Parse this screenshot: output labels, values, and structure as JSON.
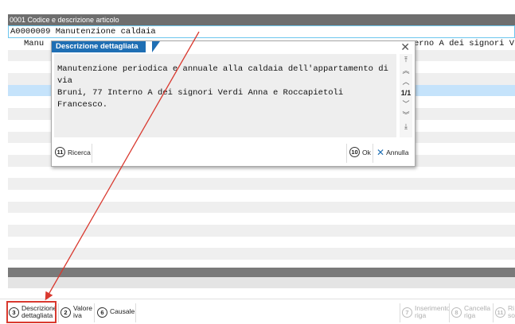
{
  "header": {
    "title": "0001  Codice e descrizione articolo"
  },
  "code_row": {
    "value": "A0000009 Manutenzione caldaia"
  },
  "grid": {
    "row1_left": "Manu",
    "row1_right": "erno A dei signori V"
  },
  "dialog": {
    "title": "Descrizione dettagliata",
    "text_line1": "Manutenzione periodica e annuale alla caldaia dell'appartamento di via",
    "text_line2": "Bruni, 77 Interno A dei signori Verdi Anna e Roccapietoli Francesco.",
    "page_indicator": "1/1",
    "buttons": {
      "search": {
        "key": "11",
        "label": "Ricerca"
      },
      "ok": {
        "key": "10",
        "label": "Ok"
      },
      "cancel": {
        "label": "Annulla"
      }
    }
  },
  "footer": {
    "buttons": [
      {
        "key": "3",
        "line1": "Descrizione",
        "line2": "dettagliata"
      },
      {
        "key": "2",
        "line1": "Valore",
        "line2": "iva"
      },
      {
        "key": "6",
        "line1": "Causale",
        "line2": ""
      },
      {
        "key": "7",
        "line1": "Inserimento",
        "line2": "riga"
      },
      {
        "key": "8",
        "line1": "Cancella",
        "line2": "riga"
      },
      {
        "key": "11",
        "line1": "Ri",
        "line2": "so"
      }
    ]
  },
  "colors": {
    "title_blue": "#1f6fb4",
    "selection_blue": "#c5e3fb",
    "annotation_red": "#d9392f"
  }
}
